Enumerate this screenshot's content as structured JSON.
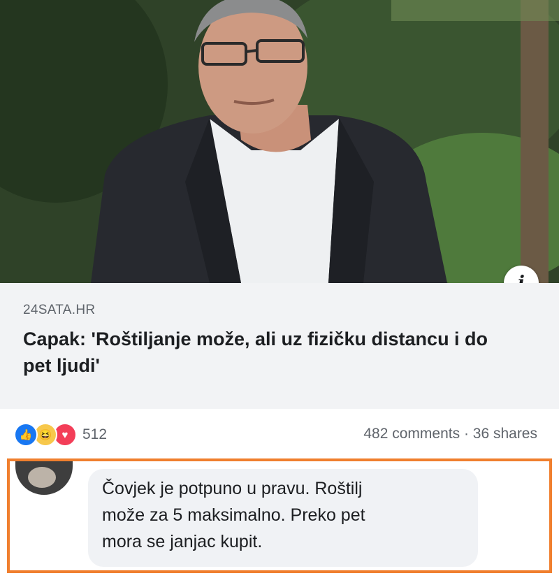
{
  "post": {
    "image": {
      "subject": "man-in-suit-photo"
    },
    "info_icon": "info-icon",
    "link": {
      "source": "24SATA.HR",
      "headline": "Capak: 'Roštiljanje može, ali uz fizičku distancu i do pet ljudi'"
    },
    "stats": {
      "reaction_icons": [
        "like-icon",
        "haha-icon",
        "love-icon"
      ],
      "reaction_count": "512",
      "comments_shares": "482 comments · 36 shares"
    }
  },
  "comment": {
    "text": "Čovjek je potpuno u pravu. Roštilj\nmože za 5  maksimalno. Preko pet\nmora se janjac kupit."
  },
  "colors": {
    "highlight_border": "#f07f2e",
    "like": "#1877f2",
    "love": "#f33e58",
    "haha": "#f7c84b"
  }
}
